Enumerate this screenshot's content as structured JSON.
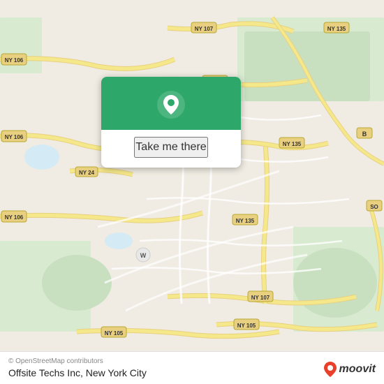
{
  "map": {
    "background_color": "#f0ece3",
    "alt": "Street map of New York City area"
  },
  "popup": {
    "button_label": "Take me there",
    "pin_icon": "location-pin"
  },
  "bottom_bar": {
    "attribution": "© OpenStreetMap contributors",
    "title": "Offsite Techs Inc, New York City"
  },
  "moovit": {
    "logo_text": "moovit"
  },
  "road_labels": [
    "NY 106",
    "NY 106",
    "NY 106",
    "NY 107",
    "NY 107",
    "NY 107",
    "NY 135",
    "NY 135",
    "NY 105",
    "NY 105",
    "NY 24",
    "B"
  ]
}
